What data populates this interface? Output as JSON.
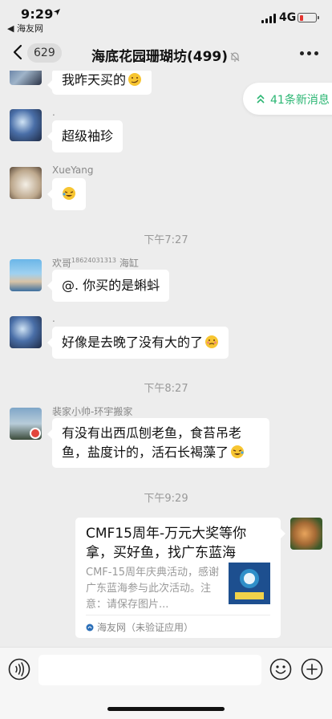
{
  "status_bar": {
    "time": "9:29",
    "back_app": "◀ 海友网",
    "network": "4G"
  },
  "nav": {
    "unread_count": "629",
    "title": "海底花园珊瑚坊(499)"
  },
  "new_messages": {
    "label": "41条新消息"
  },
  "messages": [
    {
      "sender": "",
      "text": "我昨天买的"
    },
    {
      "sender": ".",
      "text": "超级袖珍"
    },
    {
      "sender": "XueYang",
      "text": ""
    },
    {
      "type": "time",
      "text": "下午7:27"
    },
    {
      "sender_name": "欢哥",
      "sender_sup": "18624031313",
      "sender_suffix": "海缸",
      "text": "@. 你买的是蝌蚪"
    },
    {
      "sender": ".",
      "text": "好像是去晚了没有大的了"
    },
    {
      "type": "time",
      "text": "下午8:27"
    },
    {
      "sender": "裴家小帅-环宇搬家",
      "line1": "有没有出西瓜刨老鱼，食苔吊老",
      "line2": "鱼，盐度计的，活石长褐藻了"
    },
    {
      "type": "time",
      "text": "下午9:29"
    }
  ],
  "link_card": {
    "title": "CMF15周年-万元大奖等你拿，买好鱼，找广东蓝海",
    "desc": "CMF-15周年庆典活动，感谢广东蓝海参与此次活动。注意：请保存图片...",
    "source": "海友网（未验证应用）"
  },
  "colors": {
    "background": "#ededed",
    "bubble": "#ffffff",
    "accent_green": "#2bb673",
    "battery_low": "#e3342f"
  }
}
